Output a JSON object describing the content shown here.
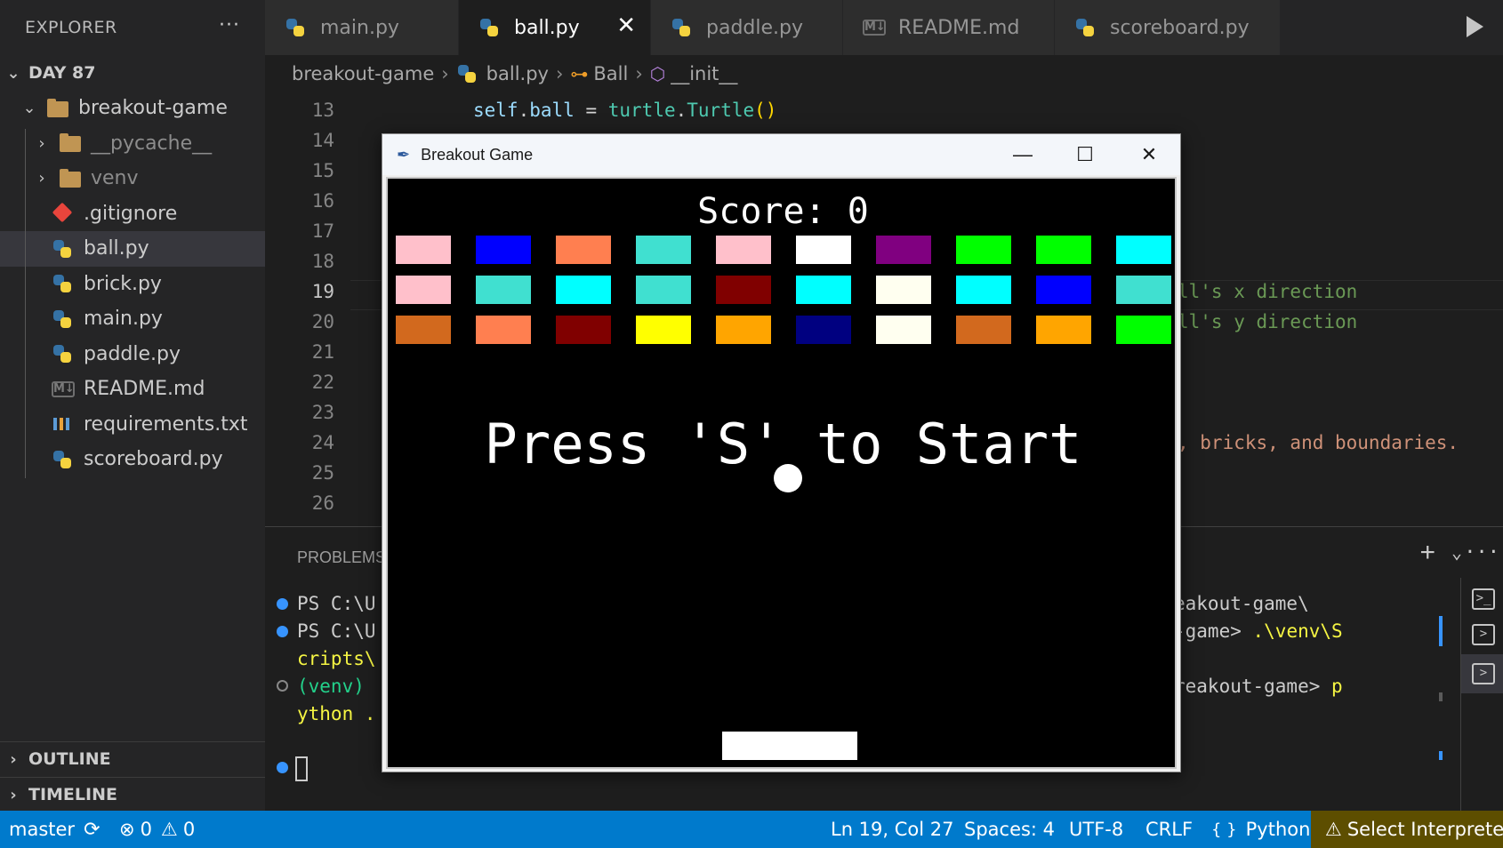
{
  "sidebar": {
    "header": "EXPLORER",
    "more": "···",
    "root": "DAY 87",
    "folder": "breakout-game",
    "items": [
      {
        "label": "__pycache__",
        "type": "folder"
      },
      {
        "label": "venv",
        "type": "folder"
      },
      {
        "label": ".gitignore",
        "type": "git"
      },
      {
        "label": "ball.py",
        "type": "py"
      },
      {
        "label": "brick.py",
        "type": "py"
      },
      {
        "label": "main.py",
        "type": "py"
      },
      {
        "label": "paddle.py",
        "type": "py"
      },
      {
        "label": "README.md",
        "type": "md"
      },
      {
        "label": "requirements.txt",
        "type": "txt"
      },
      {
        "label": "scoreboard.py",
        "type": "py"
      }
    ],
    "outline": "OUTLINE",
    "timeline": "TIMELINE"
  },
  "tabs": [
    {
      "label": "main.py"
    },
    {
      "label": "ball.py"
    },
    {
      "label": "paddle.py"
    },
    {
      "label": "README.md"
    },
    {
      "label": "scoreboard.py"
    }
  ],
  "md_icon_text": "M↓",
  "close_glyph": "✕",
  "breadcrumb": {
    "parts": [
      "breakout-game",
      "ball.py",
      "Ball",
      "__init__"
    ]
  },
  "editor": {
    "line_numbers": [
      "13",
      "14",
      "15",
      "16",
      "17",
      "18",
      "19",
      "20",
      "21",
      "22",
      "23",
      "24",
      "25",
      "26"
    ],
    "code_line_13": {
      "self": "self",
      "dot1": ".",
      "attr": "ball",
      "eq": " = ",
      "module": "turtle",
      "dot2": ".",
      "func": "Turtle",
      "parens": "()"
    },
    "comment_19": "ll's x direction",
    "comment_20": "ll's y direction",
    "string_24": ", bricks, and boundaries."
  },
  "panel": {
    "tab_label": "PROBLEMS",
    "terminal_lines": [
      "PS C:\\U",
      "PS C:\\U",
      "cripts\\",
      "(venv) ",
      "ython ."
    ],
    "terminal_right": [
      "eakout-game\\",
      "-game> .\\venv\\S",
      "reakout-game> p"
    ],
    "plus": "+",
    "caret": "⌄",
    "more": "···"
  },
  "statusbar": {
    "branch": "master",
    "errors": "0",
    "warnings": "0",
    "position": "Ln 19, Col 27",
    "spaces": "Spaces: 4",
    "encoding": "UTF-8",
    "eol": "CRLF",
    "language": "Python",
    "interpreter": "Select Interpreter",
    "braces": "{ }",
    "sync": "⟳",
    "error_icon": "⊗",
    "warning_icon": "⚠"
  },
  "game_window": {
    "title": "Breakout Game",
    "feather": "✒",
    "min": "—",
    "max": "☐",
    "close": "✕",
    "score": "Score: 0",
    "message": "Press 'S' to Start",
    "bricks": [
      [
        "#ffc0cb",
        "#0000ff",
        "#ff7f50",
        "#40e0d0",
        "#ffc0cb",
        "#ffffff",
        "#800080",
        "#00ff00",
        "#00ff00",
        "#00ffff"
      ],
      [
        "#ffc0cb",
        "#40e0d0",
        "#00ffff",
        "#40e0d0",
        "#800000",
        "#00ffff",
        "#fffff0",
        "#00ffff",
        "#0000ff",
        "#40e0d0"
      ],
      [
        "#d2691e",
        "#ff7f50",
        "#800000",
        "#ffff00",
        "#ffa500",
        "#000080",
        "#fffff0",
        "#d2691e",
        "#ffa500",
        "#00ff00"
      ]
    ]
  },
  "colors": {
    "statusbar": "#007acc",
    "accent": "#3794ff"
  }
}
